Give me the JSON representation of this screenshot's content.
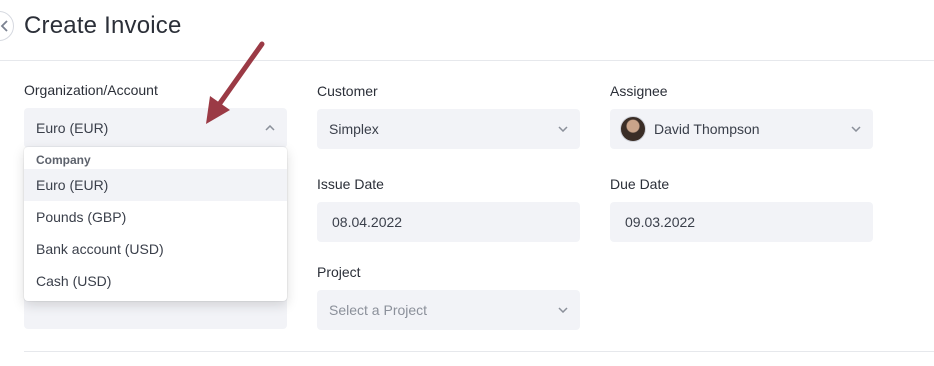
{
  "page": {
    "title": "Create Invoice"
  },
  "organization": {
    "label": "Organization/Account",
    "value": "Euro (EUR)",
    "dropdown": {
      "group_label": "Company",
      "options": [
        "Euro (EUR)",
        "Pounds (GBP)",
        "Bank account (USD)",
        "Cash (USD)"
      ],
      "selected_index": 0
    }
  },
  "customer": {
    "label": "Customer",
    "value": "Simplex"
  },
  "assignee": {
    "label": "Assignee",
    "value": "David Thompson"
  },
  "issue_date": {
    "label": "Issue Date",
    "value": "08.04.2022"
  },
  "due_date": {
    "label": "Due Date",
    "value": "09.03.2022"
  },
  "project": {
    "label": "Project",
    "placeholder": "Select a Project"
  },
  "colors": {
    "arrow": "#9b3a45",
    "field_bg": "#f2f3f7",
    "rule": "#e6e8ec"
  },
  "icons": {
    "back": "chevron-left-icon",
    "select_caret": "chevron-down-icon",
    "open_caret": "chevron-up-icon"
  }
}
